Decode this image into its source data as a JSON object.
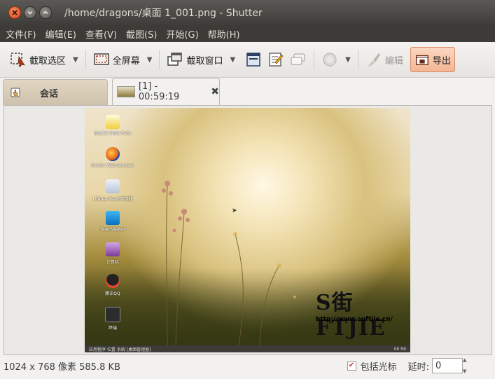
{
  "window": {
    "title": "/home/dragons/桌面 1_001.png - Shutter"
  },
  "menubar": {
    "items": [
      "文件(F)",
      "编辑(E)",
      "查看(V)",
      "截图(S)",
      "开始(G)",
      "帮助(H)"
    ]
  },
  "toolbar": {
    "select_label": "截取选区",
    "fullscreen_label": "全屏幕",
    "window_label": "截取窗口",
    "edit_label": "编辑",
    "export_label": "导出"
  },
  "tabs": {
    "session_label": "会话",
    "active_label": "[1] - 00:59:19"
  },
  "screenshot": {
    "desktop_icons": [
      "Basket Note Pads",
      "Firefox Web Browser",
      "Liferea Feed 阅读器",
      "TeamViewer",
      "计算机",
      "腾讯QQ",
      "终端"
    ],
    "watermark_url": "http://www.softjie.cn/",
    "panel_left": "应用程序  位置  系统    [桌面管理器]",
    "panel_right": "00:59"
  },
  "status": {
    "info": "1024 x 768 像素  585.8 KB",
    "include_cursor_label": "包括光标",
    "delay_label": "延时:",
    "delay_value": "0"
  },
  "colors": {
    "titlebar": "#3d3c38",
    "export_bg": "#f2b694",
    "close_button": "#d84a1d"
  }
}
